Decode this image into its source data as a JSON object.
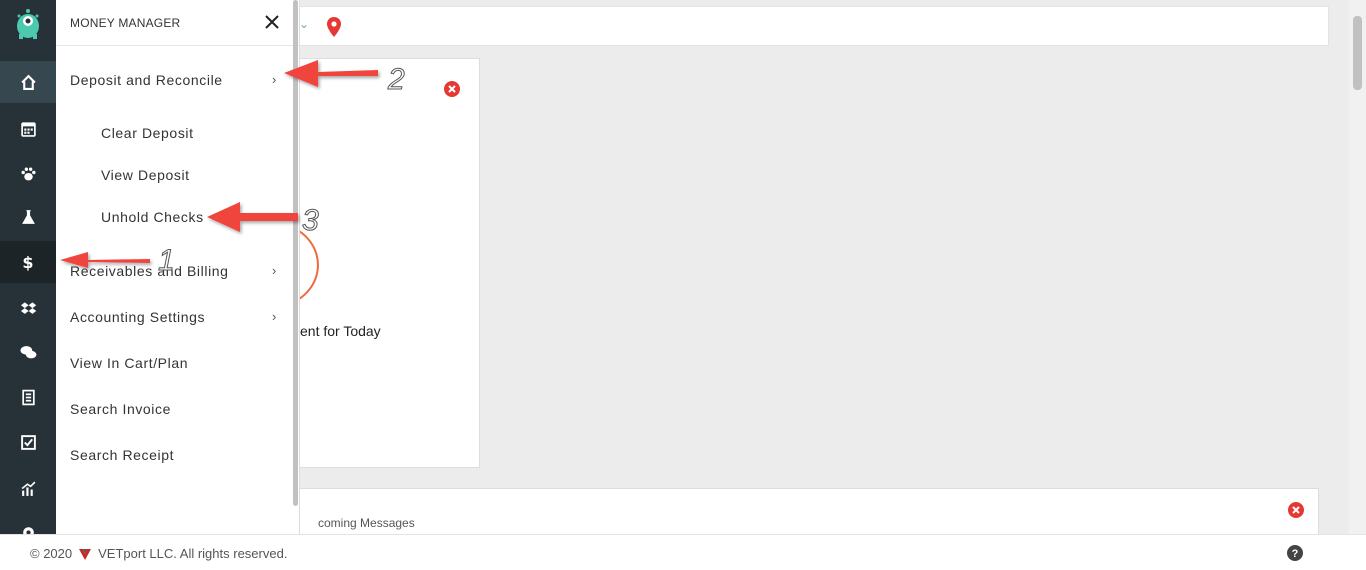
{
  "menu": {
    "title": "MONEY MANAGER",
    "items": [
      {
        "label": "Deposit and Reconcile",
        "arrow": "›"
      },
      {
        "label": "Clear Deposit"
      },
      {
        "label": "View Deposit"
      },
      {
        "label": "Unhold Checks"
      },
      {
        "label": "Receivables and Billing",
        "arrow": "›"
      },
      {
        "label": "Accounting Settings",
        "arrow": "›"
      },
      {
        "label": "View In Cart/Plan"
      },
      {
        "label": "Search Invoice"
      },
      {
        "label": "Search Receipt"
      }
    ]
  },
  "rail": {
    "icons": [
      "home-icon",
      "calendar-icon",
      "paw-icon",
      "flask-icon",
      "dollar-icon",
      "dropbox-icon",
      "chat-icon",
      "report-icon",
      "checkbox-icon",
      "chart-icon",
      "gear-icon"
    ]
  },
  "background": {
    "card_caption": "ent for Today",
    "messages_caption": "coming Messages"
  },
  "annotations": [
    "1",
    "2",
    "3"
  ],
  "footer": {
    "copyright": "© 2020",
    "company": "VETport LLC. All rights reserved."
  },
  "colors": {
    "rail": "#263238",
    "accent_red": "#e53935",
    "arrow_red": "#f0443c",
    "logo_teal": "#4cc9b0"
  }
}
